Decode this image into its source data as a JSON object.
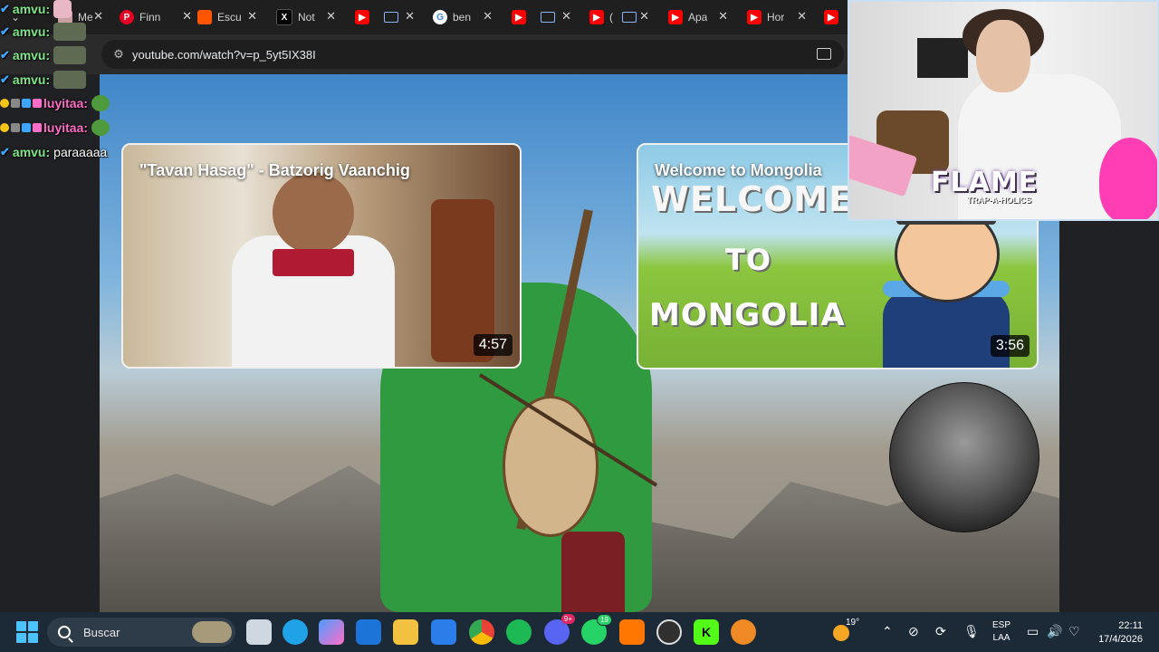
{
  "browser": {
    "tabs": [
      {
        "title": "Me",
        "icon": "pet-icon",
        "color": "#c9a0a0"
      },
      {
        "title": "Finn",
        "icon": "pinterest-icon",
        "color": "#e60023"
      },
      {
        "title": "Escu",
        "icon": "soundcloud-icon",
        "color": "#ff5500"
      },
      {
        "title": "Not",
        "icon": "x-icon",
        "color": "#000000"
      },
      {
        "title": "",
        "icon": "youtube-icon",
        "color": "#ff0000"
      },
      {
        "title": "ben",
        "icon": "google-icon",
        "color": "#ffffff"
      },
      {
        "title": "",
        "icon": "youtube-icon",
        "color": "#ff0000"
      },
      {
        "title": "(",
        "icon": "youtube-icon",
        "color": "#ff0000"
      },
      {
        "title": "Apa",
        "icon": "youtube-icon",
        "color": "#ff0000"
      },
      {
        "title": "Hor",
        "icon": "youtube-icon",
        "color": "#ff0000"
      },
      {
        "title": "",
        "icon": "youtube-icon",
        "color": "#ff0000"
      }
    ],
    "url": "youtube.com/watch?v=p_5yt5IX38I"
  },
  "video": {
    "cards": [
      {
        "title": "\"Tavan Hasag\" - Batzorig Vaanchig",
        "duration": "4:57"
      },
      {
        "title": "Welcome to Mongolia",
        "duration": "3:56",
        "art_text": [
          "WELCOME",
          "TO",
          "MONGOLIA"
        ]
      }
    ]
  },
  "chat": [
    {
      "user": "amvu",
      "suffix": ":",
      "message": "",
      "emote": "cat"
    },
    {
      "user": "amvu",
      "suffix": ":",
      "message": "",
      "emote": "frog-face"
    },
    {
      "user": "amvu",
      "suffix": ":",
      "message": "",
      "emote": "frog-face"
    },
    {
      "user": "amvu",
      "suffix": ":",
      "message": "",
      "emote": "frog-face"
    },
    {
      "user": "luyitaa",
      "suffix": ":",
      "message": "",
      "emote": "pepe"
    },
    {
      "user": "luyitaa",
      "suffix": ":",
      "message": "",
      "emote": "pepe"
    },
    {
      "user": "amvu",
      "suffix": ":",
      "message": "paraaaaa",
      "emote": ""
    }
  ],
  "webcam": {
    "overlay_title": "FLAME",
    "overlay_subtitle": "TRAP-A-HOLICS"
  },
  "taskbar": {
    "search_placeholder": "Buscar",
    "apps": [
      "task-view-icon",
      "edge-icon",
      "copilot-icon",
      "outlook-icon",
      "file-explorer-icon",
      "store-icon",
      "chrome-icon",
      "spotify-icon",
      "discord-icon",
      "whatsapp-icon",
      "soundcloud-icon",
      "obs-icon",
      "kick-icon",
      "fl-studio-icon"
    ],
    "whatsapp_badge": "19",
    "discord_badge": "9+",
    "temperature": "19°",
    "language": [
      "ESP",
      "LAA"
    ],
    "time": "22:11",
    "date": "17/4/2026"
  }
}
